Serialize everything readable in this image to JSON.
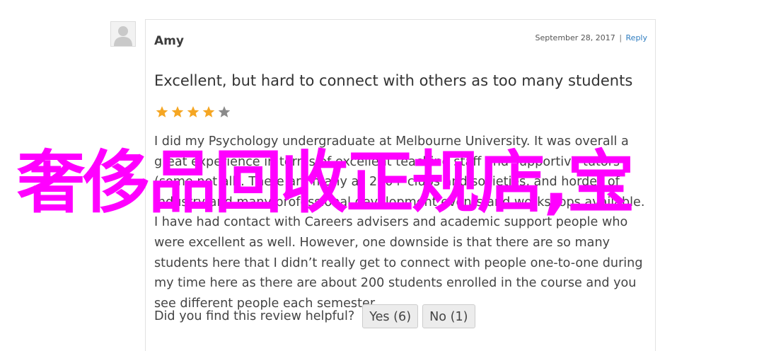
{
  "review": {
    "author": "Amy",
    "date": "September 28, 2017",
    "separator": "|",
    "reply_label": "Reply",
    "title": "Excellent, but hard to connect with others as too many students",
    "rating": 4,
    "rating_max": 5,
    "star_color_filled": "#f5a623",
    "star_color_empty": "#8a8a8a",
    "body": "I did my Psychology undergraduate at Melbourne University. It was overall a great experience in terms of excellent teaching staff and supportive tutors (some not all). There are many as 200+ clubs and societies, and hordes of industry and many professional development events and workshops available. I have had contact with Careers advisers and academic support people who were excellent as well. However, one downside is that there are so many students here that I didn’t really get to connect with people one-to-one during my time here as there are about 200 students enrolled in the course and you see different people each semester."
  },
  "helpful": {
    "question": "Did you find this review helpful?",
    "yes_label": "Yes (6)",
    "no_label": "No (1)"
  },
  "overlay": {
    "text": "奢侈品回收正规店,宝",
    "color": "#ff00ff"
  }
}
